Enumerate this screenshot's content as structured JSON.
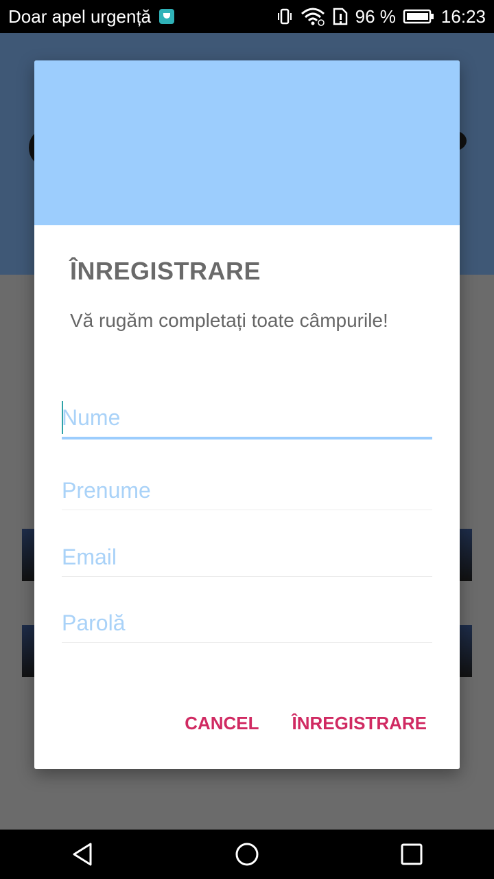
{
  "status_bar": {
    "carrier": "Doar apel urgență",
    "battery_percent": "96 %",
    "time": "16:23",
    "icons": [
      "sim-card-icon",
      "vibrate-icon",
      "wifi-icon",
      "sim-alert-icon",
      "battery-icon"
    ]
  },
  "dialog": {
    "title": "ÎNREGISTRARE",
    "message": "Vă rugăm completați toate câmpurile!",
    "banner_color": "#9ccdfd",
    "fields": {
      "nume": {
        "placeholder": "Nume",
        "value": ""
      },
      "prenume": {
        "placeholder": "Prenume",
        "value": ""
      },
      "email": {
        "placeholder": "Email",
        "value": ""
      },
      "parola": {
        "placeholder": "Parolă",
        "value": ""
      }
    },
    "buttons": {
      "cancel": "CANCEL",
      "register": "ÎNREGISTRARE"
    },
    "accent_color": "#d02a62"
  },
  "nav_bar": {
    "icons": [
      "back-icon",
      "home-icon",
      "recents-icon"
    ]
  }
}
